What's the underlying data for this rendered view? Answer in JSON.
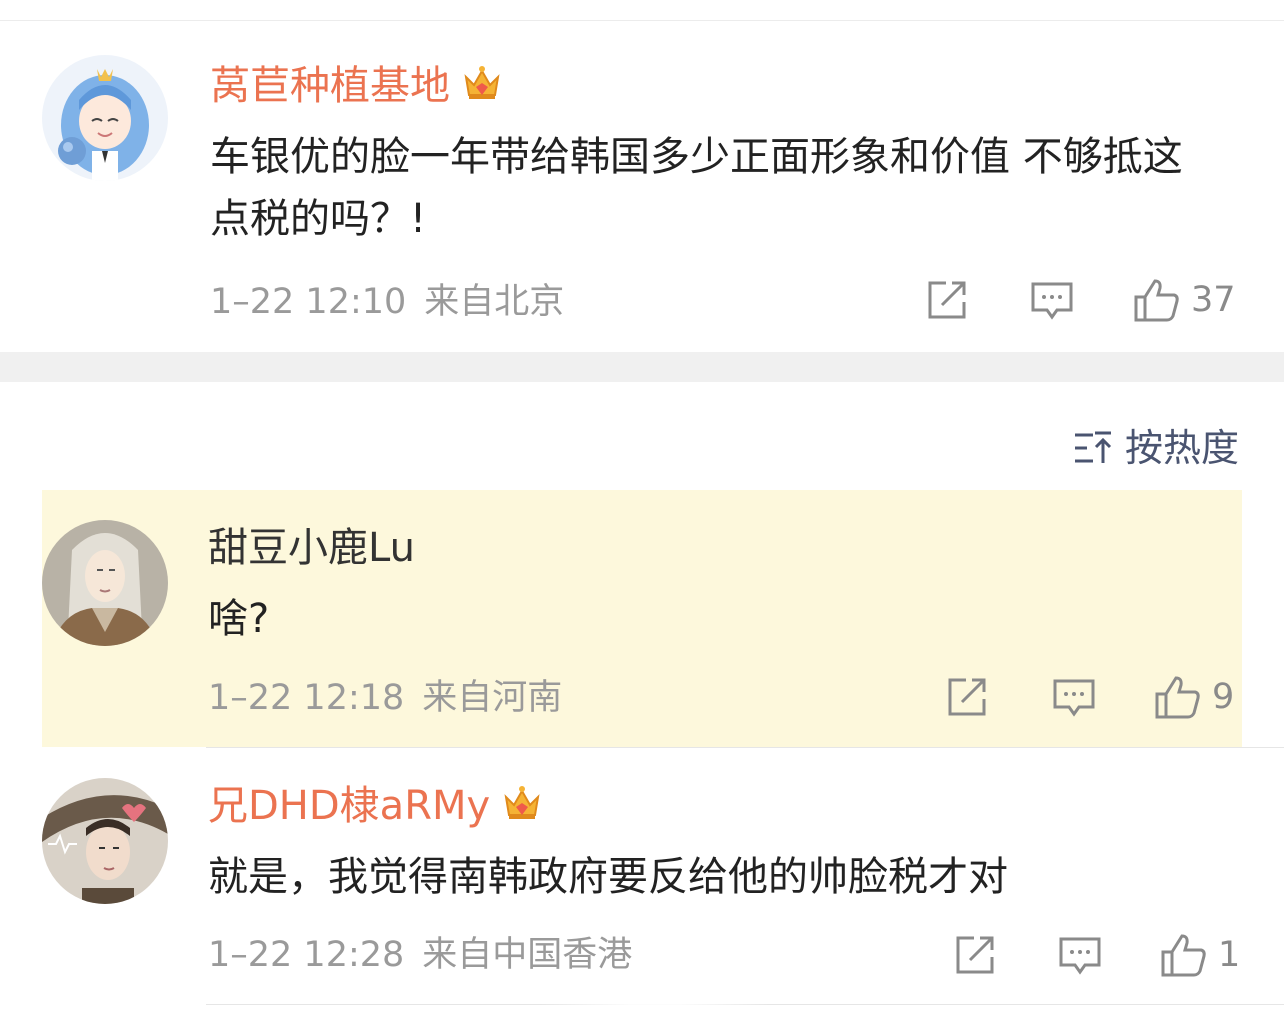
{
  "comments": [
    {
      "username": "莴苣种植基地",
      "is_vip": true,
      "text": "车银优的脸一年带给韩国多少正面形象和价值 不够抵这点税的吗？!",
      "time": "1–22 12:10",
      "location": "来自北京",
      "likes": "37"
    },
    {
      "username": "甜豆小鹿Lu",
      "is_vip": false,
      "text": "啥?",
      "time": "1–22 12:18",
      "location": "来自河南",
      "likes": "9",
      "highlighted": true
    },
    {
      "username": "兄DHD棣aRMy",
      "is_vip": true,
      "text": "就是，我觉得南韩政府要反给他的帅脸税才对",
      "time": "1–22 12:28",
      "location": "来自中国香港",
      "likes": "1"
    }
  ],
  "sort": {
    "label": "按热度"
  },
  "icons": {
    "share": "share-icon",
    "comment": "comment-icon",
    "like": "like-icon",
    "crown": "crown-icon",
    "sort": "sort-icon"
  },
  "colors": {
    "vip_name": "#eb7350",
    "highlight_bg": "#fdf8dc",
    "meta": "#9a9a9a"
  }
}
